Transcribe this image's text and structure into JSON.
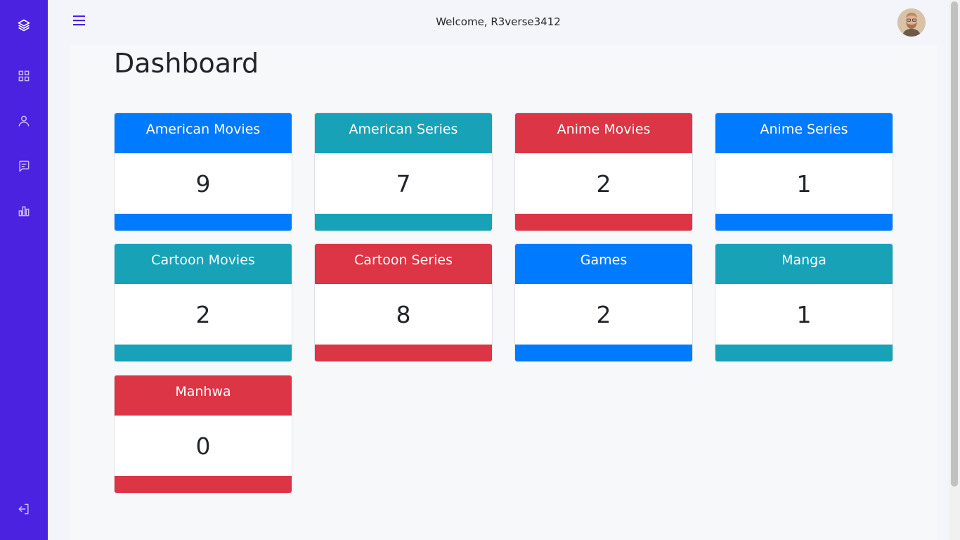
{
  "app": {
    "welcome_text": "Welcome, R3verse3412"
  },
  "colors": {
    "sidebar": "#4b22e0",
    "blue": "#007bff",
    "teal": "#17a2b8",
    "red": "#dc3545"
  },
  "sidebar": {
    "items": [
      {
        "name": "logo",
        "icon": "layers-icon"
      },
      {
        "name": "dashboard",
        "icon": "grid-icon"
      },
      {
        "name": "users",
        "icon": "user-icon"
      },
      {
        "name": "posts",
        "icon": "message-icon"
      },
      {
        "name": "stats",
        "icon": "bar-chart-icon"
      },
      {
        "name": "logout",
        "icon": "logout-icon"
      }
    ]
  },
  "dashboard": {
    "title": "Dashboard",
    "cards": [
      {
        "label": "American Movies",
        "count": "9",
        "color": "blue"
      },
      {
        "label": "American Series",
        "count": "7",
        "color": "teal"
      },
      {
        "label": "Anime Movies",
        "count": "2",
        "color": "red"
      },
      {
        "label": "Anime Series",
        "count": "1",
        "color": "blue"
      },
      {
        "label": "Cartoon Movies",
        "count": "2",
        "color": "teal"
      },
      {
        "label": "Cartoon Series",
        "count": "8",
        "color": "red"
      },
      {
        "label": "Games",
        "count": "2",
        "color": "blue"
      },
      {
        "label": "Manga",
        "count": "1",
        "color": "teal"
      },
      {
        "label": "Manhwa",
        "count": "0",
        "color": "red"
      }
    ]
  }
}
